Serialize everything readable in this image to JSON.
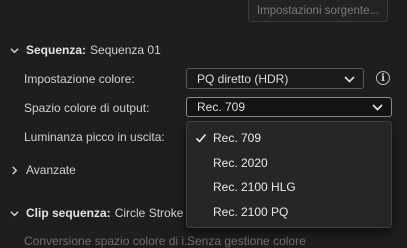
{
  "header": {
    "source_settings_label": "Impostazioni sorgente..."
  },
  "sequence": {
    "section_prefix": "Sequenza:",
    "section_name": "Sequenza 01",
    "color_setting_label": "Impostazione colore:",
    "color_setting_value": "PQ diretto (HDR)",
    "output_space_label": "Spazio colore di output:",
    "output_space_value": "Rec. 709",
    "peak_luminance_label": "Luminanza picco in uscita:",
    "advanced_label": "Avanzate"
  },
  "dropdown": {
    "options": [
      "Rec. 709",
      "Rec. 2020",
      "Rec. 2100 HLG",
      "Rec. 2100 PQ"
    ],
    "selected_index": 0
  },
  "clip": {
    "section_prefix": "Clip sequenza:",
    "section_name": "Circle Stroke Custo",
    "conversion_label": "Conversione spazio colore di i...",
    "conversion_value": "Senza gestione colore"
  },
  "icons": {
    "info": "info-icon",
    "chevron": "chevron-down-icon",
    "check": "check-icon"
  }
}
